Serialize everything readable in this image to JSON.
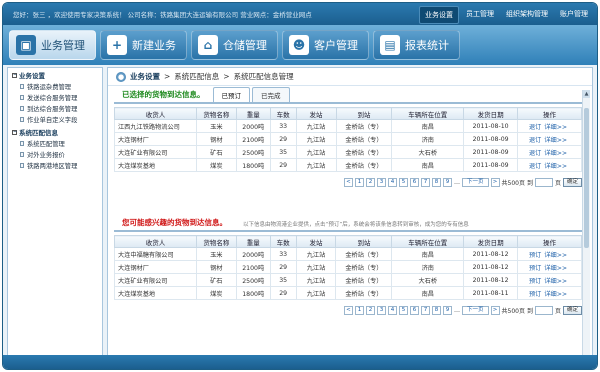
{
  "topbar": {
    "welcome": "您好：张三 ，欢迎使用专家决策系统！ 公司名称：铁路集团大连运输有限公司 营业网点：金桥营业网点",
    "links": [
      "业务设置",
      "员工管理",
      "组织架构管理",
      "账户管理"
    ]
  },
  "nav": [
    "业务管理",
    "新建业务",
    "仓储管理",
    "客户管理",
    "报表统计"
  ],
  "sidebar": {
    "groups": [
      {
        "label": "业务设置",
        "items": [
          "铁路运杂费管理",
          "发送综合服务管理",
          "到达综合服务管理",
          "作业单自定义字段"
        ]
      },
      {
        "label": "系统匹配信息",
        "items": [
          "系统匹配管理",
          "对外业务报价",
          "铁路两港地区管理"
        ]
      }
    ]
  },
  "breadcrumb": [
    "业务设置",
    "系统匹配信息",
    "系统匹配信息管理"
  ],
  "section1": {
    "title": "已选择的货物到达信息。",
    "tabs": [
      "已预订",
      "已完成"
    ]
  },
  "section2": {
    "title": "您可能感兴趣的货物到达信息。",
    "note": "以下信息由物流港企业提供，点击“预订”后，系统会将该条信息转到审核，成为您的专有信息"
  },
  "table_headers": [
    "收货人",
    "货物名称",
    "重量",
    "车数",
    "发站",
    "到站",
    "车辆所在位置",
    "发货日期",
    "操作"
  ],
  "table1_rows": [
    [
      "江西九江铁路物流公司",
      "玉米",
      "2000吨",
      "33",
      "九江站",
      "金桥站（专）",
      "南昌",
      "2011-08-10",
      "退订",
      "详细>>"
    ],
    [
      "大连钢材厂",
      "钢材",
      "2100吨",
      "29",
      "九江站",
      "金桥站（专）",
      "济南",
      "2011-08-09",
      "退订",
      "详细>>"
    ],
    [
      "大连矿业有限公司",
      "矿石",
      "2500吨",
      "35",
      "九江站",
      "金桥站（专）",
      "大石桥",
      "2011-08-09",
      "退订",
      "详细>>"
    ],
    [
      "大连煤炭基地",
      "煤炭",
      "1800吨",
      "29",
      "九江站",
      "金桥站（专）",
      "南昌",
      "2011-08-09",
      "退订",
      "详细>>"
    ]
  ],
  "table2_rows": [
    [
      "大连中福糖有限公司",
      "玉米",
      "2000吨",
      "33",
      "九江站",
      "金桥站（专）",
      "南昌",
      "2011-08-12",
      "预订",
      "详细>>"
    ],
    [
      "大连钢材厂",
      "钢材",
      "2100吨",
      "29",
      "九江站",
      "金桥站（专）",
      "济南",
      "2011-08-12",
      "预订",
      "详细>>"
    ],
    [
      "大连矿业有限公司",
      "矿石",
      "2500吨",
      "35",
      "九江站",
      "金桥站（专）",
      "大石桥",
      "2011-08-12",
      "预订",
      "详细>>"
    ],
    [
      "大连煤炭基地",
      "煤炭",
      "1800吨",
      "29",
      "九江站",
      "金桥站（专）",
      "南昌",
      "2011-08-11",
      "预订",
      "详细>>"
    ]
  ],
  "pager": {
    "prev": "<",
    "pages": [
      "1",
      "2",
      "3",
      "4",
      "5",
      "6",
      "7",
      "8",
      "9"
    ],
    "ellipsis": "…",
    "next": "下一页",
    "last": ">",
    "total": "共500页",
    "goto": "到",
    "page_suffix": "页",
    "ok": "确定"
  },
  "colors": {
    "section1_title": "#1f8a1f",
    "section2_title": "#d01818",
    "link": "#1c5fa8",
    "accent": "#2b7ab0"
  },
  "icons": {
    "nav": [
      "briefcase-icon",
      "plus-icon",
      "warehouse-icon",
      "users-icon",
      "report-icon"
    ]
  }
}
